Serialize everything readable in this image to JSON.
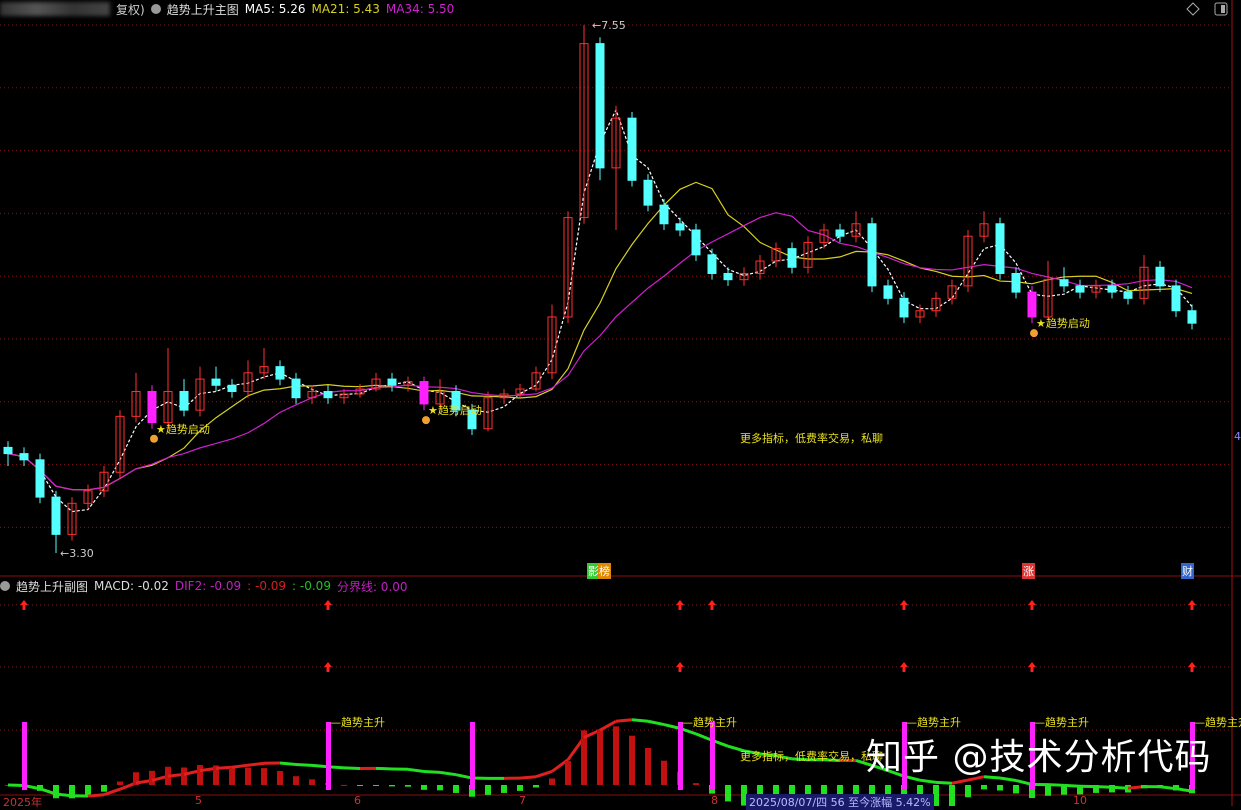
{
  "main_header": {
    "title_suffix": "复权)",
    "indicator": "趋势上升主图",
    "ma5": "MA5: 5.26",
    "ma21": "MA21: 5.43",
    "ma34": "MA34: 5.50"
  },
  "sub_header": {
    "indicator": "趋势上升副图",
    "macd": "MACD: -0.02",
    "dif2": "DIF2: -0.09",
    "v2": ": -0.09",
    "v3": ": -0.09",
    "boundary": "分界线: 0.00"
  },
  "colors": {
    "up": "#ff3030",
    "down": "#54ffff",
    "ma5": "#ffffff",
    "ma21": "#d8d020",
    "ma34": "#d020d0",
    "signal": "#ff20ff",
    "grid": "#8a1010"
  },
  "chart_data": {
    "type": "candlestick",
    "ylim": [
      3.2,
      7.7
    ],
    "max_label": "7.55",
    "min_label": "3.30",
    "candles": [
      [
        4.15,
        4.2,
        4.0,
        4.1
      ],
      [
        4.1,
        4.15,
        4.0,
        4.05
      ],
      [
        4.05,
        4.1,
        3.7,
        3.75
      ],
      [
        3.75,
        3.8,
        3.3,
        3.45
      ],
      [
        3.45,
        3.75,
        3.4,
        3.7
      ],
      [
        3.7,
        3.85,
        3.65,
        3.8
      ],
      [
        3.8,
        4.0,
        3.75,
        3.95
      ],
      [
        3.95,
        4.45,
        3.9,
        4.4
      ],
      [
        4.4,
        4.75,
        4.35,
        4.6
      ],
      [
        4.6,
        4.65,
        4.3,
        4.35
      ],
      [
        4.35,
        4.95,
        4.3,
        4.6
      ],
      [
        4.6,
        4.7,
        4.4,
        4.45
      ],
      [
        4.45,
        4.8,
        4.4,
        4.7
      ],
      [
        4.7,
        4.8,
        4.6,
        4.65
      ],
      [
        4.65,
        4.7,
        4.55,
        4.6
      ],
      [
        4.6,
        4.85,
        4.55,
        4.75
      ],
      [
        4.75,
        4.95,
        4.7,
        4.8
      ],
      [
        4.8,
        4.85,
        4.65,
        4.7
      ],
      [
        4.7,
        4.75,
        4.5,
        4.55
      ],
      [
        4.55,
        4.65,
        4.5,
        4.6
      ],
      [
        4.6,
        4.65,
        4.5,
        4.55
      ],
      [
        4.55,
        4.62,
        4.5,
        4.58
      ],
      [
        4.58,
        4.66,
        4.55,
        4.62
      ],
      [
        4.62,
        4.75,
        4.6,
        4.7
      ],
      [
        4.7,
        4.75,
        4.6,
        4.65
      ],
      [
        4.65,
        4.72,
        4.6,
        4.68
      ],
      [
        4.68,
        4.72,
        4.45,
        4.5
      ],
      [
        4.5,
        4.7,
        4.45,
        4.6
      ],
      [
        4.6,
        4.65,
        4.4,
        4.45
      ],
      [
        4.45,
        4.5,
        4.25,
        4.3
      ],
      [
        4.3,
        4.6,
        4.28,
        4.55
      ],
      [
        4.55,
        4.62,
        4.5,
        4.58
      ],
      [
        4.58,
        4.66,
        4.55,
        4.62
      ],
      [
        4.62,
        4.8,
        4.6,
        4.75
      ],
      [
        4.75,
        5.3,
        4.7,
        5.2
      ],
      [
        5.2,
        6.05,
        5.15,
        6.0
      ],
      [
        6.0,
        7.55,
        5.95,
        7.4
      ],
      [
        7.4,
        7.45,
        6.3,
        6.4
      ],
      [
        6.4,
        6.9,
        5.9,
        6.8
      ],
      [
        6.8,
        6.85,
        6.25,
        6.3
      ],
      [
        6.3,
        6.35,
        6.05,
        6.1
      ],
      [
        6.1,
        6.15,
        5.9,
        5.95
      ],
      [
        5.95,
        6.0,
        5.85,
        5.9
      ],
      [
        5.9,
        5.95,
        5.65,
        5.7
      ],
      [
        5.7,
        5.75,
        5.5,
        5.55
      ],
      [
        5.55,
        5.6,
        5.45,
        5.5
      ],
      [
        5.5,
        5.6,
        5.45,
        5.55
      ],
      [
        5.55,
        5.7,
        5.5,
        5.65
      ],
      [
        5.65,
        5.8,
        5.6,
        5.75
      ],
      [
        5.75,
        5.8,
        5.55,
        5.6
      ],
      [
        5.6,
        5.85,
        5.55,
        5.8
      ],
      [
        5.8,
        5.95,
        5.75,
        5.9
      ],
      [
        5.9,
        5.95,
        5.8,
        5.85
      ],
      [
        5.85,
        6.05,
        5.8,
        5.95
      ],
      [
        5.95,
        6.0,
        5.4,
        5.45
      ],
      [
        5.45,
        5.5,
        5.3,
        5.35
      ],
      [
        5.35,
        5.4,
        5.15,
        5.2
      ],
      [
        5.2,
        5.3,
        5.15,
        5.25
      ],
      [
        5.25,
        5.4,
        5.2,
        5.35
      ],
      [
        5.35,
        5.5,
        5.3,
        5.45
      ],
      [
        5.45,
        5.9,
        5.4,
        5.85
      ],
      [
        5.85,
        6.05,
        5.8,
        5.95
      ],
      [
        5.95,
        6.0,
        5.5,
        5.55
      ],
      [
        5.55,
        5.6,
        5.35,
        5.4
      ],
      [
        5.4,
        5.45,
        5.15,
        5.2
      ],
      [
        5.2,
        5.65,
        5.18,
        5.5
      ],
      [
        5.5,
        5.6,
        5.4,
        5.45
      ],
      [
        5.45,
        5.5,
        5.35,
        5.4
      ],
      [
        5.4,
        5.5,
        5.35,
        5.45
      ],
      [
        5.45,
        5.5,
        5.35,
        5.4
      ],
      [
        5.4,
        5.45,
        5.3,
        5.35
      ],
      [
        5.35,
        5.7,
        5.3,
        5.6
      ],
      [
        5.6,
        5.65,
        5.4,
        5.45
      ],
      [
        5.45,
        5.5,
        5.2,
        5.25
      ],
      [
        5.25,
        5.3,
        5.1,
        5.15
      ]
    ],
    "trend_start_label": "★趋势启动",
    "trend_start_indices": [
      9,
      26,
      64
    ],
    "sub_signals": {
      "arrow_row1": [
        1,
        20,
        42,
        44,
        56,
        64,
        74
      ],
      "arrow_row2": [
        20,
        42,
        56,
        64,
        74
      ],
      "bars": [
        1,
        20,
        29,
        42,
        44,
        56,
        64,
        74
      ],
      "labels": [
        20,
        42,
        56,
        64,
        74
      ],
      "bar_label": "趋势主升"
    },
    "x_labels": [
      "2025年",
      "5",
      "6",
      "7",
      "8",
      "10"
    ]
  },
  "event_tags": [
    {
      "text": "影",
      "color": "#3c3"
    },
    {
      "text": "榜",
      "color": "#d80"
    },
    {
      "text": "涨",
      "color": "#d33"
    },
    {
      "text": "财",
      "color": "#36c"
    }
  ],
  "notes": {
    "promo": "更多指标，低费率交易，私聊",
    "promo_cut": "更多指标，低费率交易，私聊"
  },
  "watermark": "知乎 @技术分析代码",
  "tooltip": "2025/08/07/四 56 至今涨幅 5.42%",
  "right_axis_label": "4"
}
